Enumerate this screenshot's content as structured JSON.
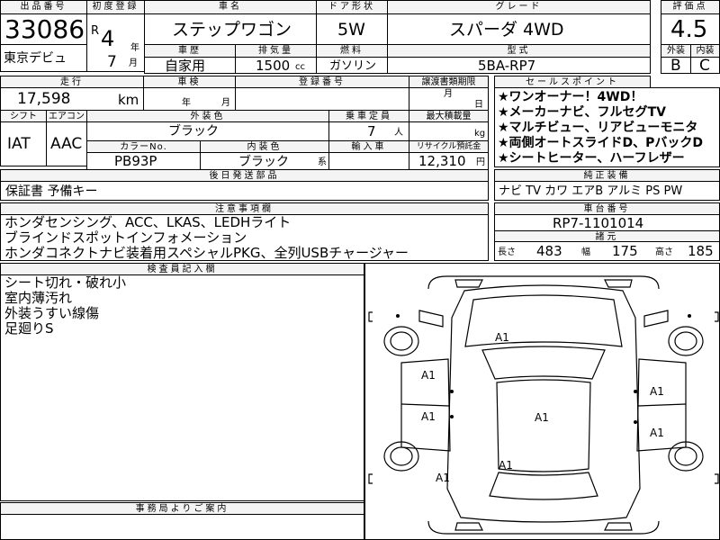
{
  "lot": {
    "header": "出品番号",
    "value": "33086",
    "venue": "東京デビュ"
  },
  "first_reg": {
    "header": "初度登録",
    "era": "R",
    "year": "4",
    "year_unit": "年",
    "month": "7",
    "month_unit": "月"
  },
  "car_name": {
    "header": "車名",
    "value": "ステップワゴン"
  },
  "door": {
    "header": "ドア形状",
    "value": "5W"
  },
  "grade": {
    "header": "グレード",
    "value": "スパーダ 4WD"
  },
  "score": {
    "header": "評価点",
    "value": "4.5",
    "exterior_header": "外装",
    "exterior": "B",
    "interior_header": "内装",
    "interior": "C"
  },
  "use": {
    "header": "車歴",
    "value": "自家用"
  },
  "displacement": {
    "header": "排気量",
    "value": "1500",
    "unit": "cc"
  },
  "fuel": {
    "header": "燃料",
    "value": "ガソリン"
  },
  "model": {
    "header": "型式",
    "value": "5BA-RP7"
  },
  "mileage": {
    "header": "走行",
    "value": "17,598",
    "unit": "km"
  },
  "inspection": {
    "header": "車検",
    "year_unit": "年",
    "month_unit": "月"
  },
  "plate": {
    "header": "登録番号",
    "value": ""
  },
  "transfer": {
    "header": "譲渡書類期限",
    "month_unit": "月",
    "day_unit": "日"
  },
  "shift": {
    "header": "シフト",
    "value": "IAT"
  },
  "aircon": {
    "header": "エアコン",
    "value": "AAC"
  },
  "ext_color": {
    "header": "外装色",
    "value": "ブラック"
  },
  "capacity": {
    "header": "乗車定員",
    "value": "7",
    "unit": "人"
  },
  "load": {
    "header": "最大積載量",
    "value": "",
    "unit": "kg"
  },
  "color_no": {
    "header": "カラーNo.",
    "value": "PB93P"
  },
  "int_color": {
    "header": "内装色",
    "value": "ブラック",
    "suffix": "系"
  },
  "import_car": {
    "header": "輸入車",
    "value": ""
  },
  "recycle": {
    "header": "リサイクル預託金",
    "value": "12,310",
    "unit": "円"
  },
  "later_docs": {
    "header": "後日発送部品",
    "value": "保証書 予備キー"
  },
  "sales_points": {
    "header": "セールスポイント",
    "items": [
      "★ワンオーナー！4WD！",
      "★メーカーナビ、フルセグTV",
      "★マルチビュー、リアビューモニタ",
      "★両側オートスライドD、PバックD",
      "★シートヒーター、ハーフレザー"
    ]
  },
  "equipment": {
    "header": "純正装備",
    "value": "ナビ TV カワ エアB アルミ PS PW"
  },
  "notes": {
    "header": "注意事項欄",
    "items": [
      "ホンダセンシング、ACC、LKAS、LEDHライト",
      "ブラインドスポットインフォメーション",
      "ホンダコネクトナビ装着用スペシャルPKG、全列USBチャージャー"
    ]
  },
  "chassis": {
    "header": "車台番号",
    "value": "RP7-1101014"
  },
  "specs": {
    "header": "諸元",
    "length_label": "長さ",
    "length": "483",
    "width_label": "幅",
    "width": "175",
    "height_label": "高さ",
    "height": "185"
  },
  "inspector": {
    "header": "検査員記入欄",
    "items": [
      "シート切れ・破れ小",
      "室内薄汚れ",
      "外装うすい線傷",
      "足廻りS"
    ]
  },
  "office": {
    "header": "事務局よりご案内"
  },
  "damage": {
    "mark": "A1"
  }
}
